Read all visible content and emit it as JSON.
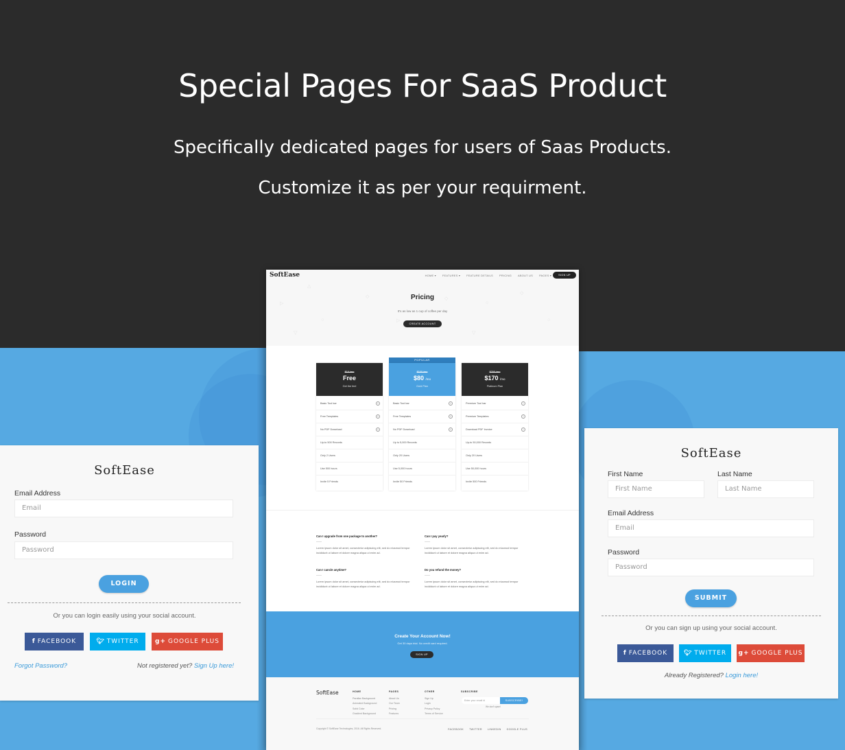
{
  "hero": {
    "title": "Special Pages For SaaS Product",
    "subtitle_line1": "Specifically dedicated pages for users of Saas Products.",
    "subtitle_line2": "Customize it as per your requirment."
  },
  "colors": {
    "dark_bg": "#2b2b2b",
    "blue": "#56a9e2",
    "accent": "#4aa1e0",
    "facebook": "#3b5998",
    "twitter": "#00aced",
    "google_plus": "#dd4b39"
  },
  "login": {
    "brand": "SoftEase",
    "email_label": "Email Address",
    "email_placeholder": "Email",
    "password_label": "Password",
    "password_placeholder": "Password",
    "login_button": "LOGIN",
    "social_note": "Or you can login easily using your social account.",
    "facebook": "FACEBOOK",
    "twitter": "TWITTER",
    "google_plus": "GOOGLE PLUS",
    "forgot": "Forgot Password?",
    "not_registered": "Not registered yet?",
    "signup_link": "Sign Up here!"
  },
  "signup": {
    "brand": "SoftEase",
    "first_name_label": "First Name",
    "first_name_placeholder": "First Name",
    "last_name_label": "Last Name",
    "last_name_placeholder": "Last Name",
    "email_label": "Email Address",
    "email_placeholder": "Email",
    "password_label": "Password",
    "password_placeholder": "Password",
    "submit_button": "SUBMIT",
    "social_note": "Or you can sign up using your social account.",
    "facebook": "FACEBOOK",
    "twitter": "TWITTER",
    "google_plus": "GOOGLE PLUS",
    "already": "Already Registered?",
    "login_link": "Login here!"
  },
  "pricing_page": {
    "logo": "SoftEase",
    "nav": [
      "HOME ▾",
      "FEATURES ▾",
      "FEATURE DETAILS",
      "PRICING",
      "ABOUT US",
      "PAGES ▾"
    ],
    "nav_signup": "SIGN UP",
    "title": "Pricing",
    "tagline": "It's as low as 1 cup of coffee per day",
    "cta": "CREATE ACCOUNT",
    "popular_label": "POPULAR",
    "plans": [
      {
        "old_price": "$10 /mo",
        "price": "Free",
        "per": "",
        "name": "Get the feel",
        "features": [
          {
            "text": "Basic Tool bar",
            "icon": "x"
          },
          {
            "text": "Free Templates",
            "icon": "x"
          },
          {
            "text": "No PDF Download",
            "icon": "x"
          },
          {
            "text": "Up-to 500 Records",
            "icon": ""
          },
          {
            "text": "Only 2 Users",
            "icon": ""
          },
          {
            "text": "Use 500 hours",
            "icon": ""
          },
          {
            "text": "Invite 5 Friends",
            "icon": ""
          }
        ]
      },
      {
        "old_price": "$100 /mo",
        "price": "$80",
        "per": "/mo",
        "name": "Gold Plan",
        "features": [
          {
            "text": "Basic Tool bar",
            "icon": "x"
          },
          {
            "text": "Free Templates",
            "icon": "x"
          },
          {
            "text": "No PDF Download",
            "icon": "x"
          },
          {
            "text": "Up to 5,000 Records",
            "icon": ""
          },
          {
            "text": "Only 20 Users",
            "icon": ""
          },
          {
            "text": "Use 5,000 hours",
            "icon": ""
          },
          {
            "text": "Invite 50 Friends",
            "icon": ""
          }
        ]
      },
      {
        "old_price": "$200 /mo",
        "price": "$170",
        "per": "/mo",
        "name": "Platinum Plan",
        "features": [
          {
            "text": "Premium Tool bar",
            "icon": "i"
          },
          {
            "text": "Premium Templates",
            "icon": "i"
          },
          {
            "text": "Download PDF Invoice",
            "icon": "i"
          },
          {
            "text": "Up-to 50,000 Records",
            "icon": ""
          },
          {
            "text": "Only 20 Users",
            "icon": ""
          },
          {
            "text": "Use 50,000 hours",
            "icon": ""
          },
          {
            "text": "Invite 500 Friends",
            "icon": ""
          }
        ]
      }
    ],
    "faq": [
      {
        "q": "Can I upgrade from one package to another?",
        "a": "Lorem ipsum dolor sit amet, consectetur adipiscing elit, sed do eiusmod tempor incididunt ut labore et dolore magna aliqua ut enim ad."
      },
      {
        "q": "Can I pay yearly?",
        "a": "Lorem ipsum dolor sit amet, consectetur adipiscing elit, sed do eiusmod tempor incididunt ut labore et dolore magna aliqua ut enim ad."
      },
      {
        "q": "Can I cancle anytime?",
        "a": "Lorem ipsum dolor sit amet, consectetur adipiscing elit, sed do eiusmod tempor incididunt ut labore et dolore magna aliqua ut enim ad."
      },
      {
        "q": "Do you refund the money?",
        "a": "Lorem ipsum dolor sit amet, consectetur adipiscing elit, sed do eiusmod tempor incididunt ut labore et dolore magna aliqua ut enim ad."
      }
    ],
    "cta_band": {
      "title": "Create Your Account Now!",
      "subtitle": "Get 30 days trial. No credit card required.",
      "button": "SIGN UP"
    },
    "footer": {
      "logo": "SoftEase",
      "columns": [
        {
          "heading": "HOME",
          "items": [
            "Parallax Background",
            "Animated Background",
            "Solid Color",
            "Gradient Background"
          ]
        },
        {
          "heading": "PAGES",
          "items": [
            "About Us",
            "Our Team",
            "Pricing",
            "Features"
          ]
        },
        {
          "heading": "OTHER",
          "items": [
            "Sign Up",
            "Login",
            "Privacy Policy",
            "Terms of Service"
          ]
        }
      ],
      "subscribe_heading": "SUBSCRIBE",
      "subscribe_placeholder": "Enter your email id",
      "subscribe_button": "SUBSCRIBE!",
      "spam_note": "We don't spam!",
      "copyright": "Copyright © SoftEase Technologies, 2016. All Rights Reserved.",
      "social": [
        "FACEBOOK",
        "TWITTER",
        "LINKEDIN",
        "GOOGLE PLUS"
      ]
    }
  }
}
